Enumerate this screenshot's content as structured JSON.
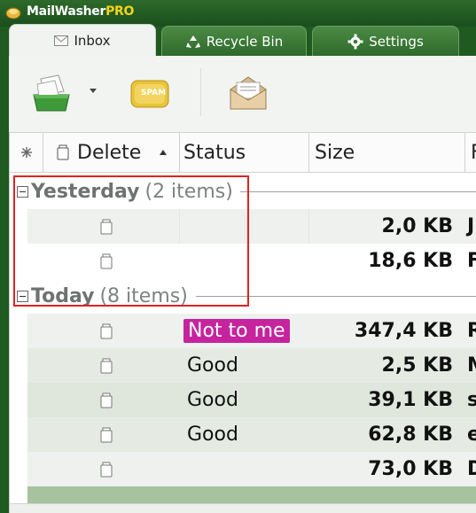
{
  "app": {
    "title_main": "MailWasher",
    "title_pro": "PRO"
  },
  "tabs": [
    {
      "label": "Inbox",
      "icon": "envelope-icon",
      "active": true
    },
    {
      "label": "Recycle Bin",
      "icon": "recycle-icon",
      "active": false
    },
    {
      "label": "Settings",
      "icon": "gear-icon",
      "active": false
    }
  ],
  "toolbar": {
    "check_mail_icon": "inbox-tray-icon",
    "spam_label": "SPAM",
    "open_mail_icon": "open-envelope-icon"
  },
  "columns": {
    "delete": "Delete",
    "status": "Status",
    "size": "Size",
    "from_partial": "F"
  },
  "groups": {
    "yesterday": {
      "label": "Yesterday",
      "count": "(2 items)"
    },
    "today": {
      "label": "Today",
      "count": "(8 items)"
    }
  },
  "rows_yesterday": [
    {
      "status": "",
      "size": "2,0 KB",
      "from": "J"
    },
    {
      "status": "",
      "size": "18,6 KB",
      "from": "F"
    }
  ],
  "rows_today": [
    {
      "status": "Not to me",
      "size": "347,4 KB",
      "from": "R",
      "badge": true
    },
    {
      "status": "Good",
      "size": "2,5 KB",
      "from": "M"
    },
    {
      "status": "Good",
      "size": "39,1 KB",
      "from": "s"
    },
    {
      "status": "Good",
      "size": "62,8 KB",
      "from": "e"
    },
    {
      "status": "",
      "size": "73,0 KB",
      "from": "D"
    }
  ],
  "colors": {
    "titlebar": "#1f5a21",
    "badge": "#c6239f",
    "good_row": "#e5ebe2",
    "highlight": "#e12222"
  }
}
